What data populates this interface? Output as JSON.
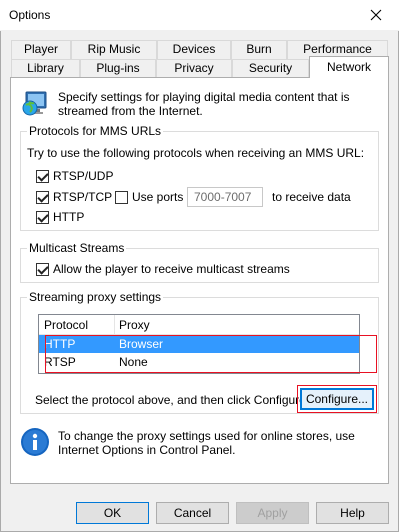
{
  "window": {
    "title": "Options"
  },
  "tabs_row1": [
    "Player",
    "Rip Music",
    "Devices",
    "Burn",
    "Performance"
  ],
  "tabs_row2": [
    "Library",
    "Plug-ins",
    "Privacy",
    "Security",
    "Network"
  ],
  "intro_text": "Specify settings for playing digital media content that is streamed from the Internet.",
  "mms": {
    "legend": "Protocols for MMS URLs",
    "instruction": "Try to use the following protocols when receiving an MMS URL:",
    "rtsp_udp": "RTSP/UDP",
    "rtsp_tcp": "RTSP/TCP",
    "use_ports": "Use ports",
    "ports_value": "7000-7007",
    "to_receive": "to receive data",
    "http": "HTTP"
  },
  "multicast": {
    "legend": "Multicast Streams",
    "allow": "Allow the player to receive multicast streams"
  },
  "proxy": {
    "legend": "Streaming proxy settings",
    "columns": [
      "Protocol",
      "Proxy"
    ],
    "rows": [
      {
        "protocol": "HTTP",
        "proxy": "Browser"
      },
      {
        "protocol": "RTSP",
        "proxy": "None"
      }
    ],
    "select_text": "Select the protocol above, and then click Configure.",
    "configure_label": "Configure..."
  },
  "info_text": "To change the proxy settings used for online stores, use Internet Options in Control Panel.",
  "buttons": {
    "ok": "OK",
    "cancel": "Cancel",
    "apply": "Apply",
    "help": "Help"
  },
  "colors": {
    "selection": "#3399ff",
    "highlight_box": "#e81123",
    "accent": "#0078d7"
  }
}
